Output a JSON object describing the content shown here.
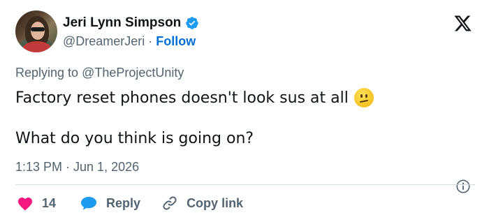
{
  "author": {
    "display_name": "Jeri Lynn Simpson",
    "handle": "@DreamerJeri",
    "separator": "·",
    "follow_label": "Follow",
    "verified_icon": "verified-badge-icon"
  },
  "reply_context": {
    "prefix": "Replying to",
    "mention": "@TheProjectUnity"
  },
  "tweet": {
    "line1": "Factory reset phones doesn't look sus at all",
    "line1_emoji": "confused-face-emoji",
    "line2": "What do you think is going on?"
  },
  "timestamp": "1:13 PM · Jun 1, 2026",
  "actions": {
    "like_count": "14",
    "reply_label": "Reply",
    "copy_link_label": "Copy link"
  },
  "icons": {
    "platform_logo": "x-logo-icon",
    "info": "info-icon",
    "like": "heart-icon",
    "reply": "reply-bubble-icon",
    "copy": "link-icon"
  },
  "colors": {
    "text_primary": "#0f1419",
    "text_secondary": "#536471",
    "link_blue": "#006fd6",
    "verified_blue": "#1d9bf0",
    "like_pink": "#f91880",
    "divider": "#cfd9de"
  }
}
